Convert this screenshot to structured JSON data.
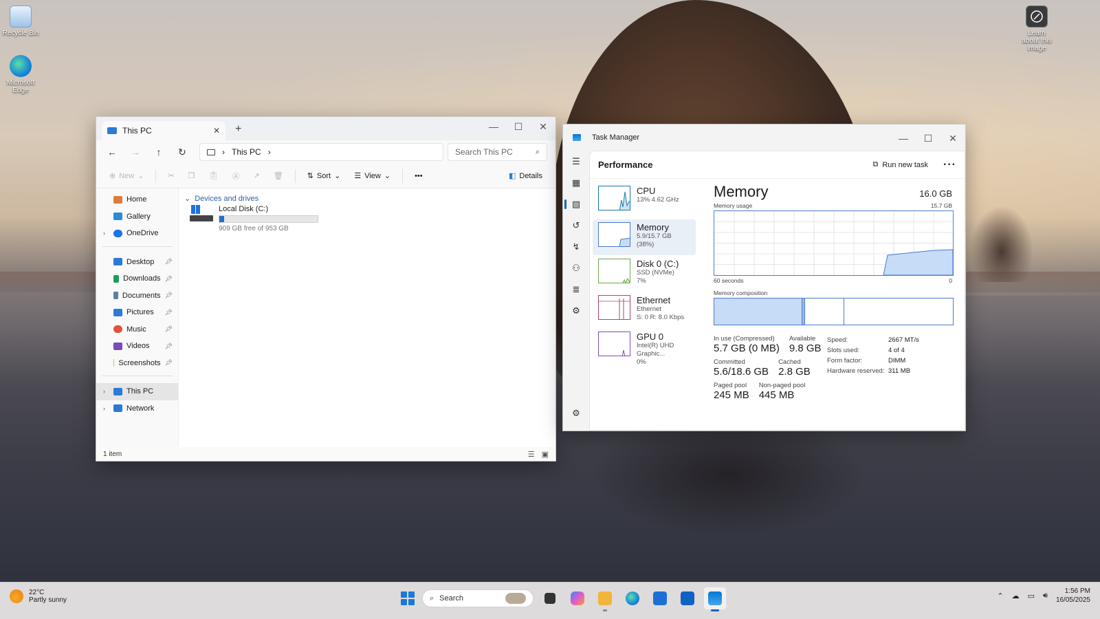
{
  "desktop": {
    "icons": [
      {
        "label": "Recycle Bin"
      },
      {
        "label": "Microsoft Edge"
      },
      {
        "label": "Learn about this image"
      }
    ]
  },
  "explorer": {
    "tab_title": "This PC",
    "breadcrumb": "This PC",
    "search_placeholder": "Search This PC",
    "commands": {
      "new": "New",
      "sort": "Sort",
      "view": "View",
      "details": "Details",
      "more": "•••"
    },
    "sidebar": [
      {
        "label": "Home",
        "color": "#e07b39"
      },
      {
        "label": "Gallery",
        "color": "#2c8ad8"
      },
      {
        "label": "OneDrive",
        "color": "#1a73e8"
      },
      {
        "label": "Desktop",
        "color": "#2b7bd6"
      },
      {
        "label": "Downloads",
        "color": "#1a9e5a"
      },
      {
        "label": "Documents",
        "color": "#5b7fa8"
      },
      {
        "label": "Pictures",
        "color": "#2b7bd6"
      },
      {
        "label": "Music",
        "color": "#e0533c"
      },
      {
        "label": "Videos",
        "color": "#7b4bb8"
      },
      {
        "label": "Screenshots",
        "color": "#f0b429"
      },
      {
        "label": "This PC",
        "color": "#2b7bd6"
      },
      {
        "label": "Network",
        "color": "#2b7bd6"
      }
    ],
    "group_label": "Devices and drives",
    "drive": {
      "name": "Local Disk (C:)",
      "free_text": "909 GB free of 953 GB",
      "used_fraction": 0.046
    },
    "status": "1 item"
  },
  "taskmgr": {
    "title": "Task Manager",
    "page_title": "Performance",
    "run_task": "Run new task",
    "resources": [
      {
        "name": "CPU",
        "sub1": "13% 4.62 GHz",
        "sub2": "",
        "sub3": ""
      },
      {
        "name": "Memory",
        "sub1": "5.9/15.7 GB (38%)",
        "sub2": "",
        "sub3": ""
      },
      {
        "name": "Disk 0 (C:)",
        "sub1": "SSD (NVMe)",
        "sub2": "7%",
        "sub3": ""
      },
      {
        "name": "Ethernet",
        "sub1": "Ethernet",
        "sub2": "S: 0 R: 8.0 Kbps",
        "sub3": ""
      },
      {
        "name": "GPU 0",
        "sub1": "Intel(R) UHD Graphic...",
        "sub2": "0%",
        "sub3": ""
      }
    ],
    "detail": {
      "title": "Memory",
      "total": "16.0 GB",
      "usage_label": "Memory usage",
      "usage_max": "15.7 GB",
      "x_left": "60 seconds",
      "x_right": "0",
      "composition_label": "Memory composition",
      "stats": {
        "in_use_label": "In use (Compressed)",
        "in_use": "5.7 GB (0 MB)",
        "available_label": "Available",
        "available": "9.8 GB",
        "committed_label": "Committed",
        "committed": "5.6/18.6 GB",
        "cached_label": "Cached",
        "cached": "2.8 GB",
        "paged_label": "Paged pool",
        "paged": "245 MB",
        "nonpaged_label": "Non-paged pool",
        "nonpaged": "445 MB"
      },
      "specs": [
        {
          "k": "Speed:",
          "v": "2667 MT/s"
        },
        {
          "k": "Slots used:",
          "v": "4 of 4"
        },
        {
          "k": "Form factor:",
          "v": "DIMM"
        },
        {
          "k": "Hardware reserved:",
          "v": "311 MB"
        }
      ]
    }
  },
  "taskbar": {
    "weather_temp": "22°C",
    "weather_desc": "Partly sunny",
    "search_label": "Search",
    "time": "1:56 PM",
    "date": "16/05/2025"
  },
  "colors": {
    "accent": "#0067c0",
    "memory_line": "#4a7bd0",
    "memory_fill": "#c7dcf7"
  }
}
